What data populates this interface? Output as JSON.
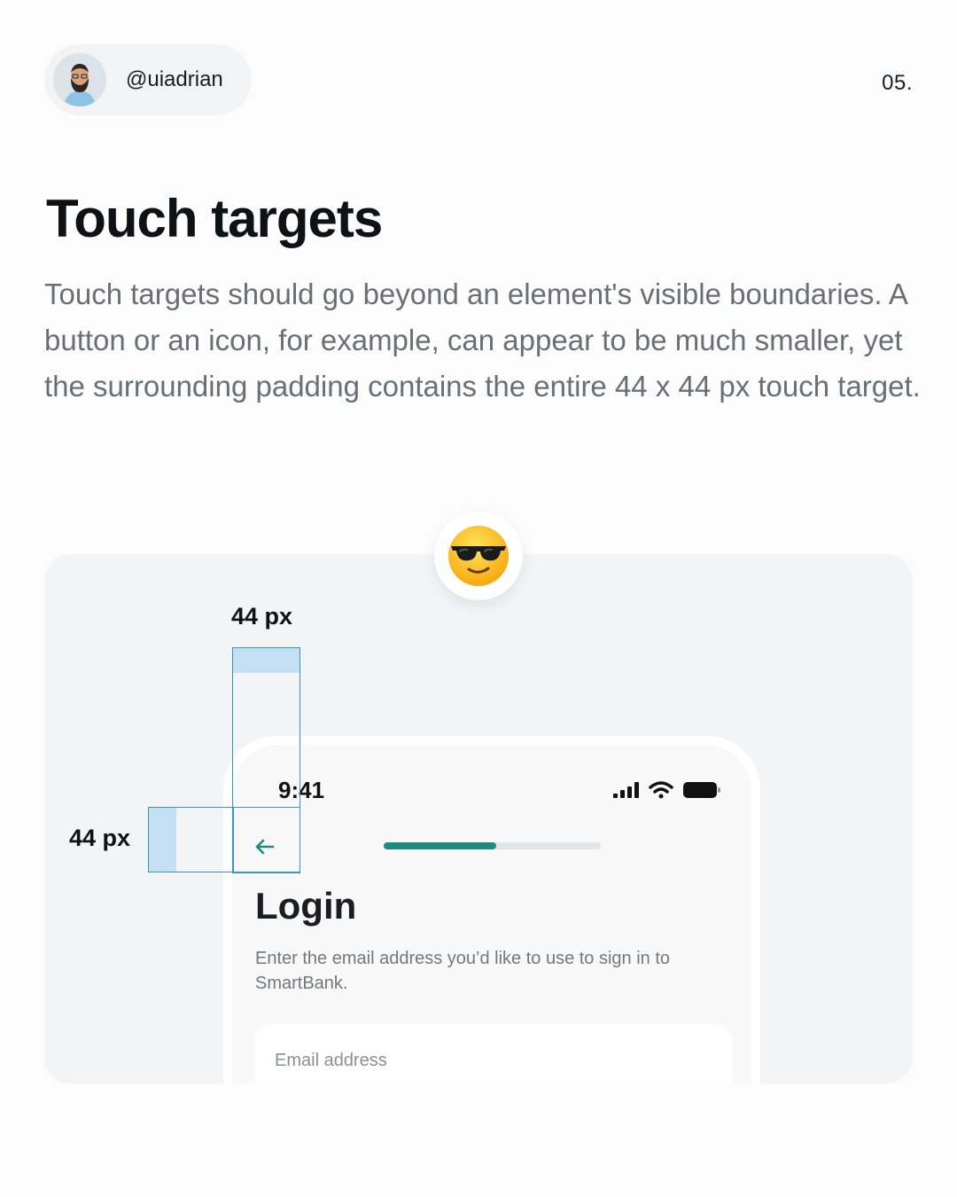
{
  "author": {
    "handle": "@uiadrian"
  },
  "page_number": "05.",
  "title": "Touch targets",
  "description": "Touch targets should go beyond an element's visible boundaries. A button or an icon, for example, can appear to be much smaller, yet the surrounding padding contains the entire 44 x 44 px touch target.",
  "illustration": {
    "emoji": "smiling-face-with-sunglasses",
    "label_vertical": "44 px",
    "label_horizontal": "44 px",
    "phone": {
      "time": "9:41",
      "progress": 0.52,
      "login_title": "Login",
      "login_description": "Enter the email address you’d like to use to sign in to SmartBank.",
      "email_placeholder": "Email address"
    }
  },
  "colors": {
    "accent": "#1f8a7e",
    "target_outline": "#3a93c8",
    "target_fill": "#c5e0f3"
  }
}
